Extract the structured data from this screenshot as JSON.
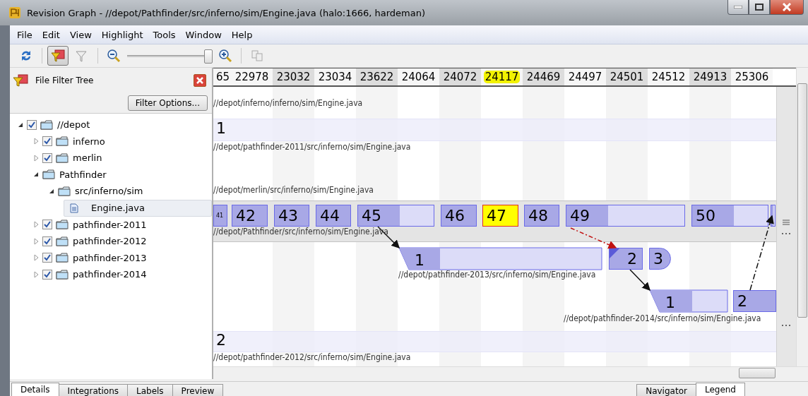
{
  "window": {
    "title": "Revision Graph - //depot/Pathfinder/src/inferno/sim/Engine.java (halo:1666, hardeman)"
  },
  "menu": [
    "File",
    "Edit",
    "View",
    "Highlight",
    "Tools",
    "Window",
    "Help"
  ],
  "toolbar": {
    "filter_pressed": true,
    "zoom": {
      "level": 0.95
    }
  },
  "filter_panel": {
    "title": "File Filter Tree",
    "button": "Filter Options...",
    "tree": [
      {
        "label": "//depot",
        "checked": true,
        "expanded": true,
        "children": [
          {
            "label": "inferno",
            "checked": true,
            "expanded": false
          },
          {
            "label": "merlin",
            "checked": true,
            "expanded": false
          },
          {
            "label": "Pathfinder",
            "expanded": true,
            "children": [
              {
                "label": "src/inferno/sim",
                "expanded": true,
                "children": [
                  {
                    "label": "Engine.java",
                    "kind": "file",
                    "selected": true
                  }
                ]
              }
            ]
          },
          {
            "label": "pathfinder-2011",
            "checked": true,
            "expanded": false
          },
          {
            "label": "pathfinder-2012",
            "checked": true,
            "expanded": false
          },
          {
            "label": "pathfinder-2013",
            "checked": true,
            "expanded": false
          },
          {
            "label": "pathfinder-2014",
            "checked": true,
            "expanded": false
          }
        ]
      }
    ]
  },
  "graph": {
    "revisions": [
      {
        "label": "65",
        "highlighted": false
      },
      {
        "label": "22978",
        "highlighted": false
      },
      {
        "label": "23032",
        "highlighted": false
      },
      {
        "label": "23034",
        "highlighted": false
      },
      {
        "label": "23622",
        "highlighted": false
      },
      {
        "label": "24064",
        "highlighted": false
      },
      {
        "label": "24072",
        "highlighted": false
      },
      {
        "label": "24117",
        "highlighted": true
      },
      {
        "label": "24469",
        "highlighted": false
      },
      {
        "label": "24497",
        "highlighted": false
      },
      {
        "label": "24501",
        "highlighted": false
      },
      {
        "label": "24512",
        "highlighted": false
      },
      {
        "label": "24913",
        "highlighted": false
      },
      {
        "label": "25306",
        "highlighted": false
      }
    ],
    "lanes": [
      {
        "path": "//depot/inferno/inferno/sim/Engine.java"
      },
      {
        "path": "//depot/pathfinder-2011/src/inferno/sim/Engine.java",
        "nodes": [
          {
            "label": "1",
            "kind": "plain",
            "highlighted": false
          }
        ]
      },
      {
        "path": "//depot/merlin/src/inferno/sim/Engine.java"
      },
      {
        "path": "//depot/Pathfinder/src/inferno/sim/Engine.java",
        "nodes": [
          {
            "label": "41",
            "kind": "small",
            "highlighted": false
          },
          {
            "label": "42",
            "kind": "box",
            "highlighted": false
          },
          {
            "label": "43",
            "kind": "box",
            "highlighted": false
          },
          {
            "label": "44",
            "kind": "box",
            "highlighted": false
          },
          {
            "label": "45",
            "kind": "box",
            "highlighted": false
          },
          {
            "label": "46",
            "kind": "box",
            "highlighted": false
          },
          {
            "label": "47",
            "kind": "box",
            "highlighted": true
          },
          {
            "label": "48",
            "kind": "box",
            "highlighted": false
          },
          {
            "label": "49",
            "kind": "box",
            "highlighted": false
          },
          {
            "label": "50",
            "kind": "box",
            "highlighted": false
          },
          {
            "kind": "box",
            "highlighted": false
          }
        ]
      },
      {
        "path": "//depot/pathfinder-2013/src/inferno/sim/Engine.java",
        "nodes": [
          {
            "label": "1",
            "kind": "branch",
            "highlighted": false
          },
          {
            "label": "2",
            "kind": "integrated",
            "highlighted": false
          },
          {
            "label": "3",
            "kind": "end",
            "highlighted": false
          }
        ]
      },
      {
        "path": "//depot/pathfinder-2014/src/inferno/sim/Engine.java",
        "nodes": [
          {
            "label": "1",
            "kind": "branch",
            "highlighted": false
          },
          {
            "label": "2",
            "kind": "box",
            "highlighted": false
          }
        ]
      },
      {
        "path": "//depot/pathfinder-2012/src/inferno/sim/Engine.java",
        "nodes": [
          {
            "label": "2",
            "kind": "plain",
            "highlighted": false
          }
        ]
      }
    ],
    "edges": [
      {
        "kind": "branch"
      },
      {
        "kind": "merge"
      },
      {
        "kind": "branch"
      },
      {
        "kind": "copy"
      }
    ]
  },
  "bottom_tabs_left": [
    {
      "label": "Details",
      "selected": true
    },
    {
      "label": "Integrations",
      "selected": false
    },
    {
      "label": "Labels",
      "selected": false
    },
    {
      "label": "Preview",
      "selected": false
    }
  ],
  "bottom_tabs_right": [
    {
      "label": "Navigator",
      "selected": false
    },
    {
      "label": "Legend",
      "selected": true
    }
  ]
}
